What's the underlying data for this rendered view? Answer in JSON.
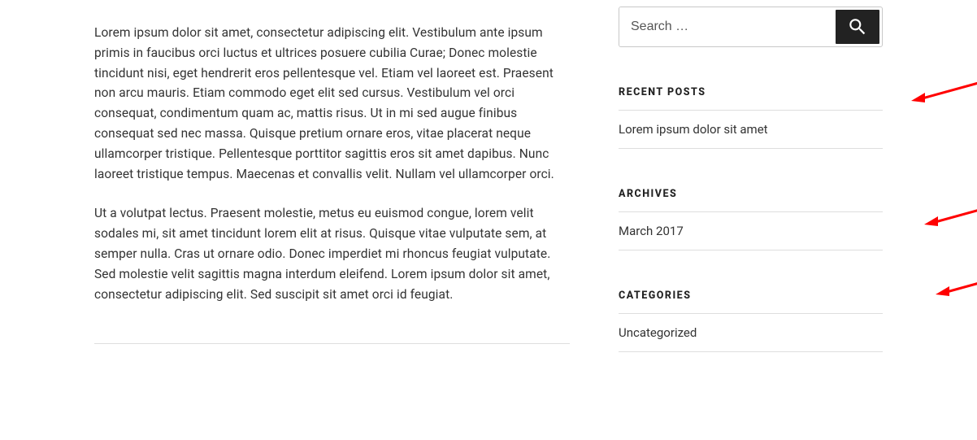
{
  "main": {
    "para1": "Lorem ipsum dolor sit amet, consectetur adipiscing elit. Vestibulum ante ipsum primis in faucibus orci luctus et ultrices posuere cubilia Curae; Donec molestie tincidunt nisi, eget hendrerit eros pellentesque vel. Etiam vel laoreet est. Praesent non arcu mauris. Etiam commodo eget elit sed cursus. Vestibulum vel orci consequat, condimentum quam ac, mattis risus. Ut in mi sed augue finibus consequat sed nec massa. Quisque pretium ornare eros, vitae placerat neque ullamcorper tristique. Pellentesque porttitor sagittis eros sit amet dapibus. Nunc laoreet tristique tempus. Maecenas et convallis velit. Nullam vel ullamcorper orci.",
    "para2": "Ut a volutpat lectus. Praesent molestie, metus eu euismod congue, lorem velit sodales mi, sit amet tincidunt lorem elit at risus. Quisque vitae vulputate sem, at semper nulla. Cras ut ornare odio. Donec imperdiet mi rhoncus feugiat vulputate. Sed molestie velit sagittis magna interdum eleifend. Lorem ipsum dolor sit amet, consectetur adipiscing elit. Sed suscipit sit amet orci id feugiat."
  },
  "search": {
    "placeholder": "Search …"
  },
  "widgets": {
    "recent_posts": {
      "title": "RECENT POSTS",
      "items": [
        {
          "label": "Lorem ipsum dolor sit amet"
        }
      ]
    },
    "archives": {
      "title": "ARCHIVES",
      "items": [
        {
          "label": "March 2017"
        }
      ]
    },
    "categories": {
      "title": "CATEGORIES",
      "items": [
        {
          "label": "Uncategorized"
        }
      ]
    }
  },
  "annotations": {
    "arrow_color": "#ff0000"
  }
}
